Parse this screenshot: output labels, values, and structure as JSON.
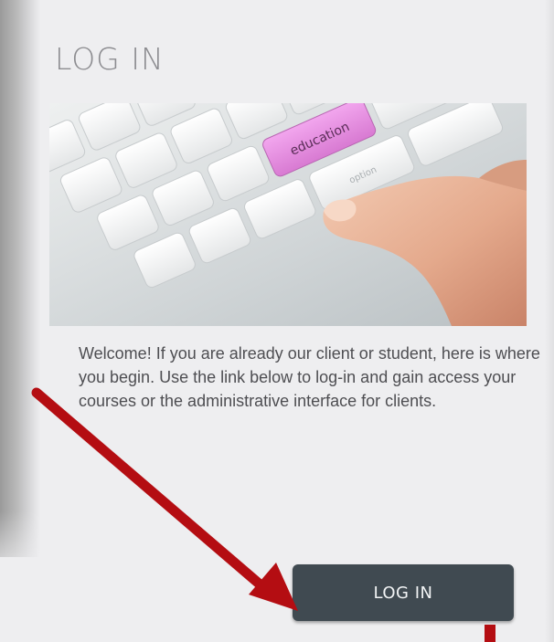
{
  "login_panel": {
    "heading": "LOG IN",
    "welcome_text": "Welcome! If you are already our client or student, here is where you begin. Use the link below to log-in and gain access your courses or the administrative interface for clients.",
    "button_label": "LOG IN"
  },
  "hero_image": {
    "key_label": "education",
    "key_label_2": "option"
  },
  "colors": {
    "background": "#eeeef0",
    "heading": "#8c8c90",
    "body_text": "#4e4e52",
    "button_bg": "#404a51",
    "button_text": "#f2f4f5",
    "highlight_key": "#e98ce3",
    "arrow": "#b40d12"
  },
  "annotations": {
    "arrow_icon": "red-arrow-icon",
    "marker_icon": "red-marker-icon"
  }
}
